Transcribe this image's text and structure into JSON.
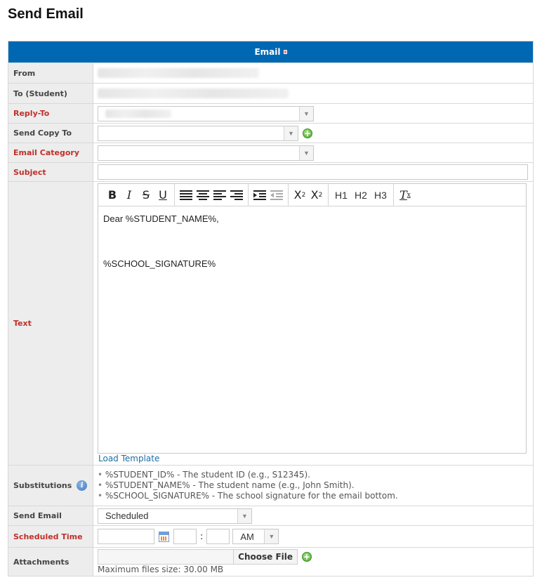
{
  "page": {
    "title": "Send Email"
  },
  "form": {
    "header": "Email",
    "rows": {
      "from": {
        "label": "From"
      },
      "to": {
        "label": "To (Student)"
      },
      "reply_to": {
        "label": "Reply-To",
        "value": ""
      },
      "send_copy_to": {
        "label": "Send Copy To",
        "value": ""
      },
      "email_category": {
        "label": "Email Category",
        "value": ""
      },
      "subject": {
        "label": "Subject",
        "value": ""
      },
      "text": {
        "label": "Text",
        "toolbar": {
          "bold": "B",
          "italic": "I",
          "strike": "S",
          "underline": "U",
          "h1": "H1",
          "h2": "H2",
          "h3": "H3"
        },
        "body_lines": [
          "Dear %STUDENT_NAME%,",
          "%SCHOOL_SIGNATURE%"
        ],
        "load_template": "Load Template"
      },
      "substitutions": {
        "label": "Substitutions",
        "items": [
          "%STUDENT_ID% - The student ID (e.g., S12345).",
          "%STUDENT_NAME% - The student name (e.g., John Smith).",
          "%SCHOOL_SIGNATURE% - The school signature for the email bottom."
        ]
      },
      "send_email": {
        "label": "Send Email",
        "value": "Scheduled"
      },
      "scheduled_time": {
        "label": "Scheduled Time",
        "date": "",
        "hour": "",
        "minute": "",
        "ampm": "AM"
      },
      "attachments": {
        "label": "Attachments",
        "button": "Choose File",
        "hint": "Maximum files size: 30.00 MB"
      }
    }
  },
  "colors": {
    "header_bg": "#0068b3",
    "required_label": "#c0302a",
    "link": "#1c6ea4"
  },
  "icons": [
    "add-icon",
    "info-icon",
    "calendar-icon",
    "dropdown-arrow-icon"
  ]
}
